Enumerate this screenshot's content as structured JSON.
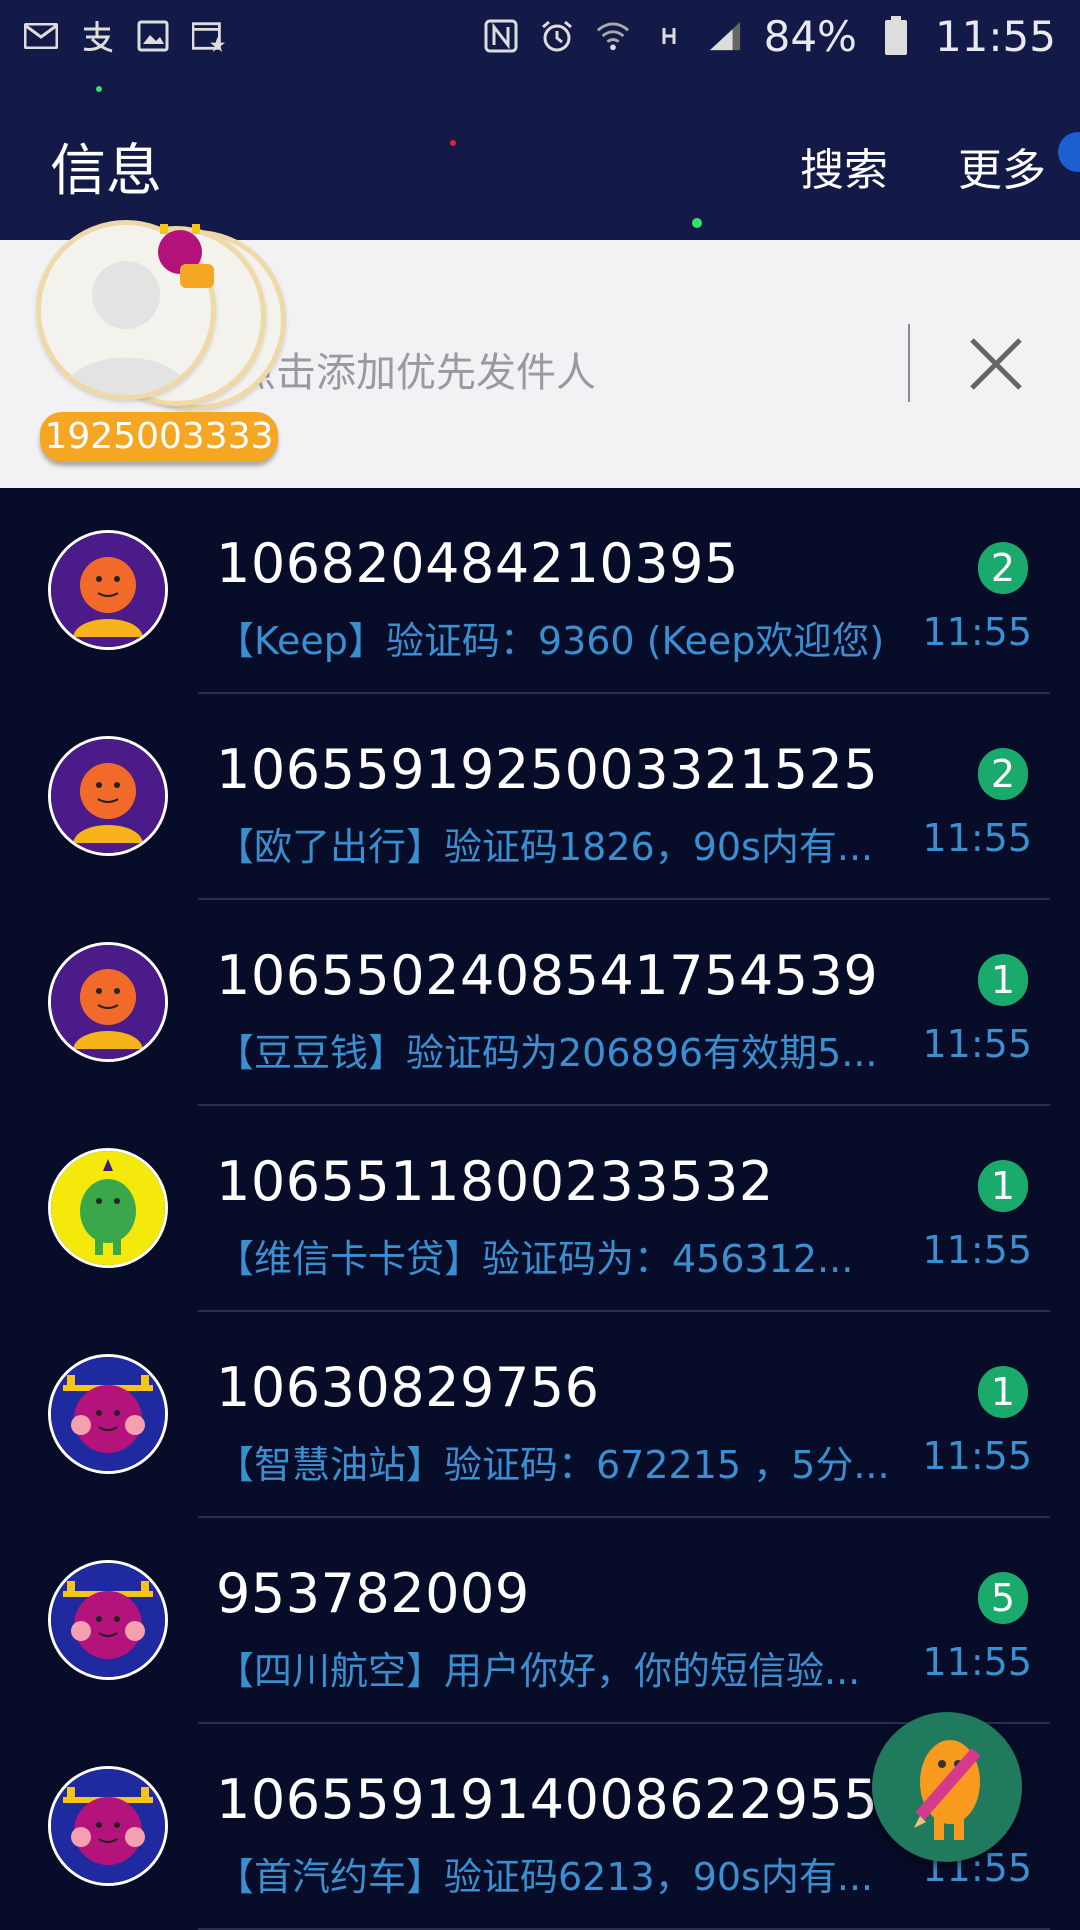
{
  "status_bar": {
    "left_icons": [
      "mail-icon",
      "alipay-icon",
      "image-icon",
      "calendar-star-icon"
    ],
    "right_icons": [
      "nfc-icon",
      "alarm-icon",
      "wifi-icon",
      "h-network-icon",
      "signal-icon"
    ],
    "battery": "84%",
    "time": "11:55"
  },
  "app_bar": {
    "title": "信息",
    "search_label": "搜索",
    "more_label": "更多"
  },
  "priority_sender": {
    "placeholder": "点击添加优先发件人"
  },
  "floating_widget": {
    "badge_text": "1925003333"
  },
  "colors": {
    "header_bg": "#141a48",
    "list_bg": "#070c28",
    "preview_text": "#3a8fd0",
    "count_badge": "#1aaa6c",
    "widget_badge": "#f5a623"
  },
  "messages": [
    {
      "sender": "106820484210395",
      "preview": "【Keep】验证码：9360 (Keep欢迎您)",
      "time": "11:55",
      "count": "2",
      "avatar": "orange-monster-avatar"
    },
    {
      "sender": "1065591925003321525",
      "preview": "【欧了出行】验证码1826，90s内有...",
      "time": "11:55",
      "count": "2",
      "avatar": "orange-monster-avatar"
    },
    {
      "sender": "1065502408541754539",
      "preview": "【豆豆钱】验证码为206896有效期5...",
      "time": "11:55",
      "count": "1",
      "avatar": "orange-monster-avatar"
    },
    {
      "sender": "1065511800233532",
      "preview": "【维信卡卡贷】验证码为：456312...",
      "time": "11:55",
      "count": "1",
      "avatar": "green-monster-avatar"
    },
    {
      "sender": "10630829756",
      "preview": "【智慧油站】验证码：672215 ，5分...",
      "time": "11:55",
      "count": "1",
      "avatar": "pink-monster-avatar"
    },
    {
      "sender": "953782009",
      "preview": "【四川航空】用户你好，你的短信验...",
      "time": "11:55",
      "count": "5",
      "avatar": "pink-monster-avatar"
    },
    {
      "sender": "1065591914008622955",
      "preview": "【首汽约车】验证码6213，90s内有...",
      "time": "11:55",
      "count": "",
      "avatar": "pink-monster-avatar"
    }
  ],
  "fab": {
    "icon": "compose-monster-icon"
  }
}
